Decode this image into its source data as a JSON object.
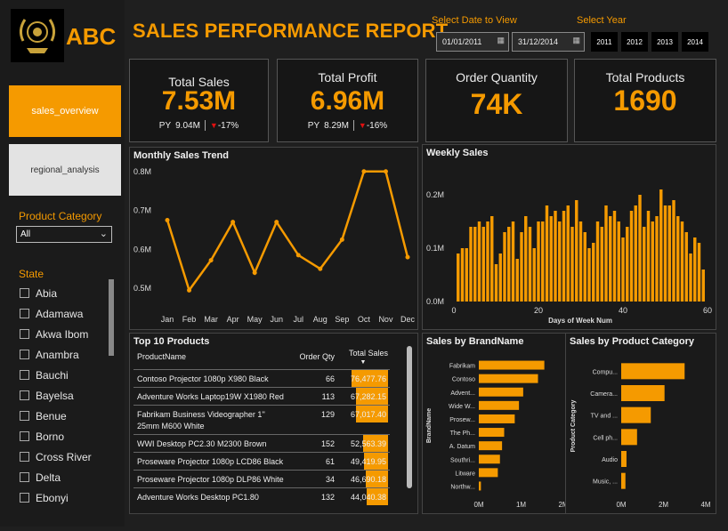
{
  "app": {
    "brand": "ABC",
    "title": "SALES PERFORMANCE REPORT"
  },
  "nav": [
    {
      "label": "sales_overview",
      "active": true
    },
    {
      "label": "regional_analysis",
      "active": false
    }
  ],
  "filters": {
    "product_category_label": "Product Category",
    "product_category_value": "All",
    "state_label": "State",
    "states": [
      "Abia",
      "Adamawa",
      "Akwa Ibom",
      "Anambra",
      "Bauchi",
      "Bayelsa",
      "Benue",
      "Borno",
      "Cross River",
      "Delta",
      "Ebonyi"
    ]
  },
  "date_filter": {
    "label": "Select Date to View",
    "start": "01/01/2011",
    "end": "31/12/2014"
  },
  "year_filter": {
    "label": "Select Year",
    "years": [
      "2011",
      "2012",
      "2013",
      "2014"
    ]
  },
  "kpis": {
    "total_sales": {
      "label": "Total Sales",
      "value": "7.53M",
      "py_label": "PY",
      "py_value": "9.04M",
      "change": "-17%"
    },
    "total_profit": {
      "label": "Total Profit",
      "value": "6.96M",
      "py_label": "PY",
      "py_value": "8.29M",
      "change": "-16%"
    },
    "order_quantity": {
      "label": "Order Quantity",
      "value": "74K"
    },
    "total_products": {
      "label": "Total Products",
      "value": "1690"
    }
  },
  "colors": {
    "accent": "#f59a00",
    "negative": "#e01010",
    "background": "#1f1f1f"
  },
  "chart_data": [
    {
      "type": "line",
      "title": "Monthly Sales Trend",
      "categories": [
        "Jan",
        "Feb",
        "Mar",
        "Apr",
        "May",
        "Jun",
        "Jul",
        "Aug",
        "Sep",
        "Oct",
        "Nov",
        "Dec"
      ],
      "values": [
        0.675,
        0.495,
        0.572,
        0.67,
        0.54,
        0.67,
        0.585,
        0.55,
        0.625,
        0.8,
        0.8,
        0.58
      ],
      "y_ticks": [
        "0.5M",
        "0.6M",
        "0.7M",
        "0.8M"
      ],
      "ylim": [
        0.45,
        0.82
      ]
    },
    {
      "type": "bar",
      "title": "Weekly Sales",
      "xlabel": "Days of Week Num",
      "x_ticks": [
        "0",
        "20",
        "40",
        "60"
      ],
      "y_ticks": [
        "0.0M",
        "0.1M",
        "0.2M"
      ],
      "xlim": [
        0,
        60
      ],
      "ylim": [
        0,
        0.26
      ],
      "values": [
        0.09,
        0.1,
        0.1,
        0.14,
        0.14,
        0.15,
        0.14,
        0.15,
        0.16,
        0.07,
        0.09,
        0.13,
        0.14,
        0.15,
        0.08,
        0.13,
        0.16,
        0.14,
        0.1,
        0.15,
        0.15,
        0.18,
        0.16,
        0.17,
        0.15,
        0.17,
        0.18,
        0.14,
        0.19,
        0.15,
        0.13,
        0.1,
        0.11,
        0.15,
        0.14,
        0.18,
        0.16,
        0.17,
        0.15,
        0.12,
        0.14,
        0.17,
        0.18,
        0.2,
        0.14,
        0.17,
        0.15,
        0.16,
        0.21,
        0.18,
        0.18,
        0.19,
        0.16,
        0.15,
        0.13,
        0.09,
        0.12,
        0.11,
        0.06
      ]
    },
    {
      "type": "bar",
      "orientation": "horizontal",
      "title": "Sales by BrandName",
      "ylabel": "BrandName",
      "categories": [
        "Fabrikam",
        "Contoso",
        "Advent...",
        "Wide W...",
        "Prosew...",
        "The Ph...",
        "A. Datum",
        "Southri...",
        "Litware",
        "Northw..."
      ],
      "values": [
        1.55,
        1.4,
        1.05,
        0.95,
        0.85,
        0.6,
        0.55,
        0.5,
        0.45,
        0.05
      ],
      "x_ticks": [
        "0M",
        "1M",
        "2M"
      ],
      "xlim": [
        0,
        2
      ]
    },
    {
      "type": "bar",
      "orientation": "horizontal",
      "title": "Sales by Product Category",
      "ylabel": "Product Category",
      "categories": [
        "Compu...",
        "Camera...",
        "TV and ...",
        "Cell ph...",
        "Audio",
        "Music, ..."
      ],
      "values": [
        3.0,
        2.05,
        1.4,
        0.75,
        0.25,
        0.2
      ],
      "x_ticks": [
        "0M",
        "2M",
        "4M"
      ],
      "xlim": [
        0,
        4
      ]
    }
  ],
  "top_products": {
    "title": "Top 10 Products",
    "columns": [
      "ProductName",
      "Order Qty",
      "Total Sales"
    ],
    "max_sales": 76477.76,
    "rows": [
      {
        "name": "Contoso Projector 1080p X980 Black",
        "qty": "66",
        "sales": "76,477.76",
        "sales_num": 76477.76
      },
      {
        "name": "Adventure Works Laptop19W X1980 Red",
        "qty": "113",
        "sales": "67,282.15",
        "sales_num": 67282.15
      },
      {
        "name": "Fabrikam Business Videographer 1'' 25mm M600 White",
        "qty": "129",
        "sales": "67,017.40",
        "sales_num": 67017.4
      },
      {
        "name": "WWI Desktop PC2.30 M2300 Brown",
        "qty": "152",
        "sales": "52,563.39",
        "sales_num": 52563.39
      },
      {
        "name": "Proseware Projector 1080p LCD86 Black",
        "qty": "61",
        "sales": "49,419.95",
        "sales_num": 49419.95
      },
      {
        "name": "Proseware Projector 1080p DLP86 White",
        "qty": "34",
        "sales": "46,690.18",
        "sales_num": 46690.18
      },
      {
        "name": "Adventure Works Desktop PC1.80",
        "qty": "132",
        "sales": "44,040.38",
        "sales_num": 44040.38
      }
    ]
  }
}
